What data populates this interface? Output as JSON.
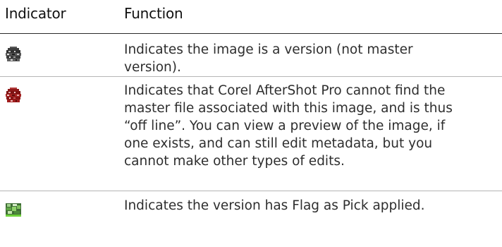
{
  "header": {
    "indicator_label": "Indicator",
    "function_label": "Function"
  },
  "rows": [
    {
      "icon": "version-icon",
      "icon_color": "#4a4a4a",
      "lines": [
        "Indicates the image is a version (not master",
        "version)."
      ]
    },
    {
      "icon": "offline-icon",
      "icon_color": "#9b1b1b",
      "lines": [
        "Indicates that Corel AfterShot Pro cannot find the",
        "master file associated with this image, and is thus",
        "“off line”. You can view a preview of the image, if",
        "one exists, and can still edit metadata, but you",
        "cannot make other types of edits."
      ]
    },
    {
      "icon": "flag-pick-icon",
      "icon_color": "#5cb82e",
      "lines": [
        "Indicates the version has Flag as Pick applied."
      ]
    }
  ]
}
